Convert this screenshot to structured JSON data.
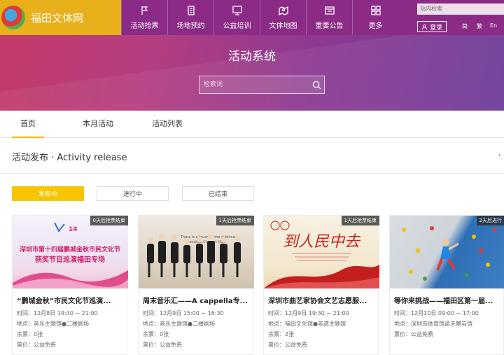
{
  "header": {
    "site_name": "福田文体网",
    "nav": [
      {
        "label": "活动抢票",
        "icon": "flag-icon"
      },
      {
        "label": "场地预约",
        "icon": "building-icon"
      },
      {
        "label": "公益培训",
        "icon": "screen-icon"
      },
      {
        "label": "文体地图",
        "icon": "map-pin-icon"
      },
      {
        "label": "重要公告",
        "icon": "notice-icon"
      },
      {
        "label": "更多",
        "icon": "grid-icon"
      }
    ],
    "search_placeholder": "站内检索",
    "login_label": "登录",
    "lang": [
      "简",
      "繁",
      "En"
    ]
  },
  "banner": {
    "title": "活动系统",
    "search_placeholder": "检索词"
  },
  "tabs": [
    "首页",
    "本月活动",
    "活动列表"
  ],
  "section": {
    "title": "活动发布 · Activity release",
    "filters": [
      "发布中",
      "进行中",
      "已结束"
    ]
  },
  "cards": [
    {
      "badge": "0天后抢票结束",
      "poster_lines": [
        "深圳市第十四届鹏城金秋市民文化节",
        "获奖节目巡演福田专场"
      ],
      "title": "“鹏城金秋”市民文化节巡演...",
      "time": "时间：12月8日 19:30 ~ 21:00",
      "place": "地点：音乐主题馆●二楼剧场",
      "tickets": "余票：0张",
      "price": "票价：公益免费"
    },
    {
      "badge": "1天后抢票结束",
      "poster_lines": [
        "There is a touch of the sublime",
        "Shenzhen Concert Hall"
      ],
      "title": "周末音乐汇——A cappella专...",
      "time": "时间：12月9日 15:00 ~ 16:30",
      "place": "地点：音乐主题馆●二楼剧场",
      "tickets": "余票：0张",
      "price": "票价：公益免费"
    },
    {
      "badge": "1天后抢票结束",
      "poster_lines": [
        "到人民中去"
      ],
      "title": "深圳市曲艺家协会文艺志愿服...",
      "time": "时间：12月9日 19:30 ~ 21:00",
      "place": "地点：福田文化馆●非遗主题馆",
      "tickets": "余票：2张",
      "price": "票价：公益免费"
    },
    {
      "badge": "2天后进行",
      "poster_lines": [],
      "title": "等你来挑战——福田区第一届...",
      "time": "时间：12月10日 09:00 ~ 17:00",
      "place": "地点：深圳市体育馆蓝天攀岩馆",
      "tickets": "",
      "price": "票价：公益免费"
    }
  ],
  "colors": {
    "accent": "#f7c600",
    "topbar": "#8b2b86",
    "logo_bg": "#e8b01a"
  }
}
